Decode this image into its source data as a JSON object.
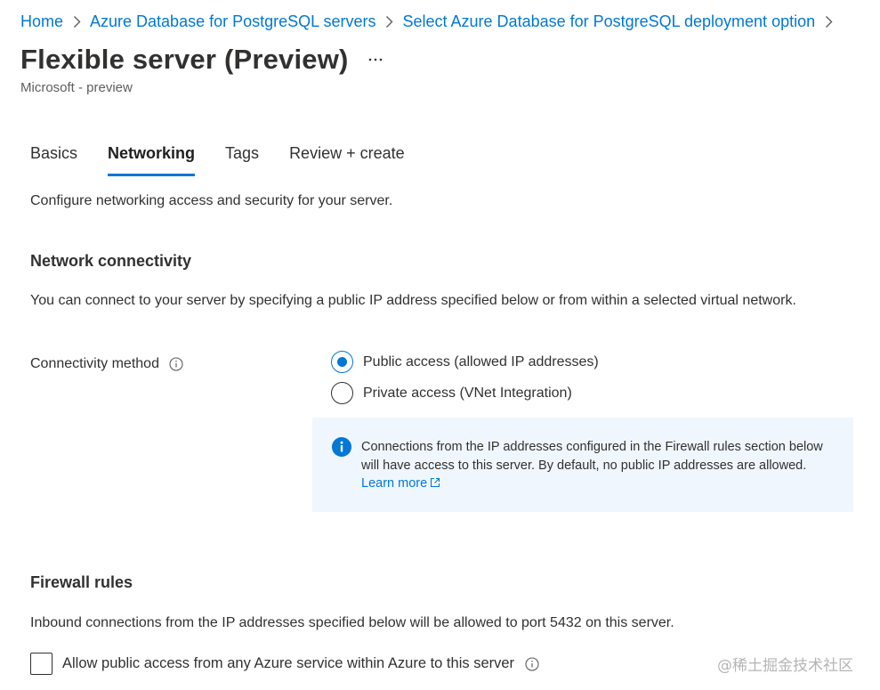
{
  "breadcrumb": {
    "items": [
      "Home",
      "Azure Database for PostgreSQL servers",
      "Select Azure Database for PostgreSQL deployment option"
    ]
  },
  "header": {
    "title": "Flexible server (Preview)",
    "more_label": "...",
    "subtitle": "Microsoft - preview"
  },
  "tabs": [
    {
      "label": "Basics",
      "active": false
    },
    {
      "label": "Networking",
      "active": true
    },
    {
      "label": "Tags",
      "active": false
    },
    {
      "label": "Review + create",
      "active": false
    }
  ],
  "main": {
    "description": "Configure networking access and security for your server.",
    "network": {
      "heading": "Network connectivity",
      "text": "You can connect to your server by specifying a public IP address specified below or from within a selected virtual network.",
      "connectivity_label": "Connectivity method",
      "options": [
        {
          "label": "Public access (allowed IP addresses)",
          "selected": true
        },
        {
          "label": "Private access (VNet Integration)",
          "selected": false
        }
      ],
      "info_text": "Connections from the IP addresses configured in the Firewall rules section below will have access to this server. By default, no public IP addresses are allowed.",
      "learn_more": "Learn more"
    },
    "firewall": {
      "heading": "Firewall rules",
      "text": "Inbound connections from the IP addresses specified below will be allowed to port 5432 on this server.",
      "checkbox_label": "Allow public access from any Azure service within Azure to this server",
      "checkbox_checked": false
    }
  },
  "watermark": "@稀土掘金技术社区",
  "colors": {
    "accent": "#0078d4",
    "text": "#323130",
    "secondary_text": "#605e5c",
    "info_background": "#f0f6fd"
  },
  "icons": {
    "separator": "chevron-right-icon",
    "more": "more-ellipsis-icon",
    "info": "info-icon",
    "info_filled": "info-filled-icon",
    "external": "external-link-icon"
  }
}
